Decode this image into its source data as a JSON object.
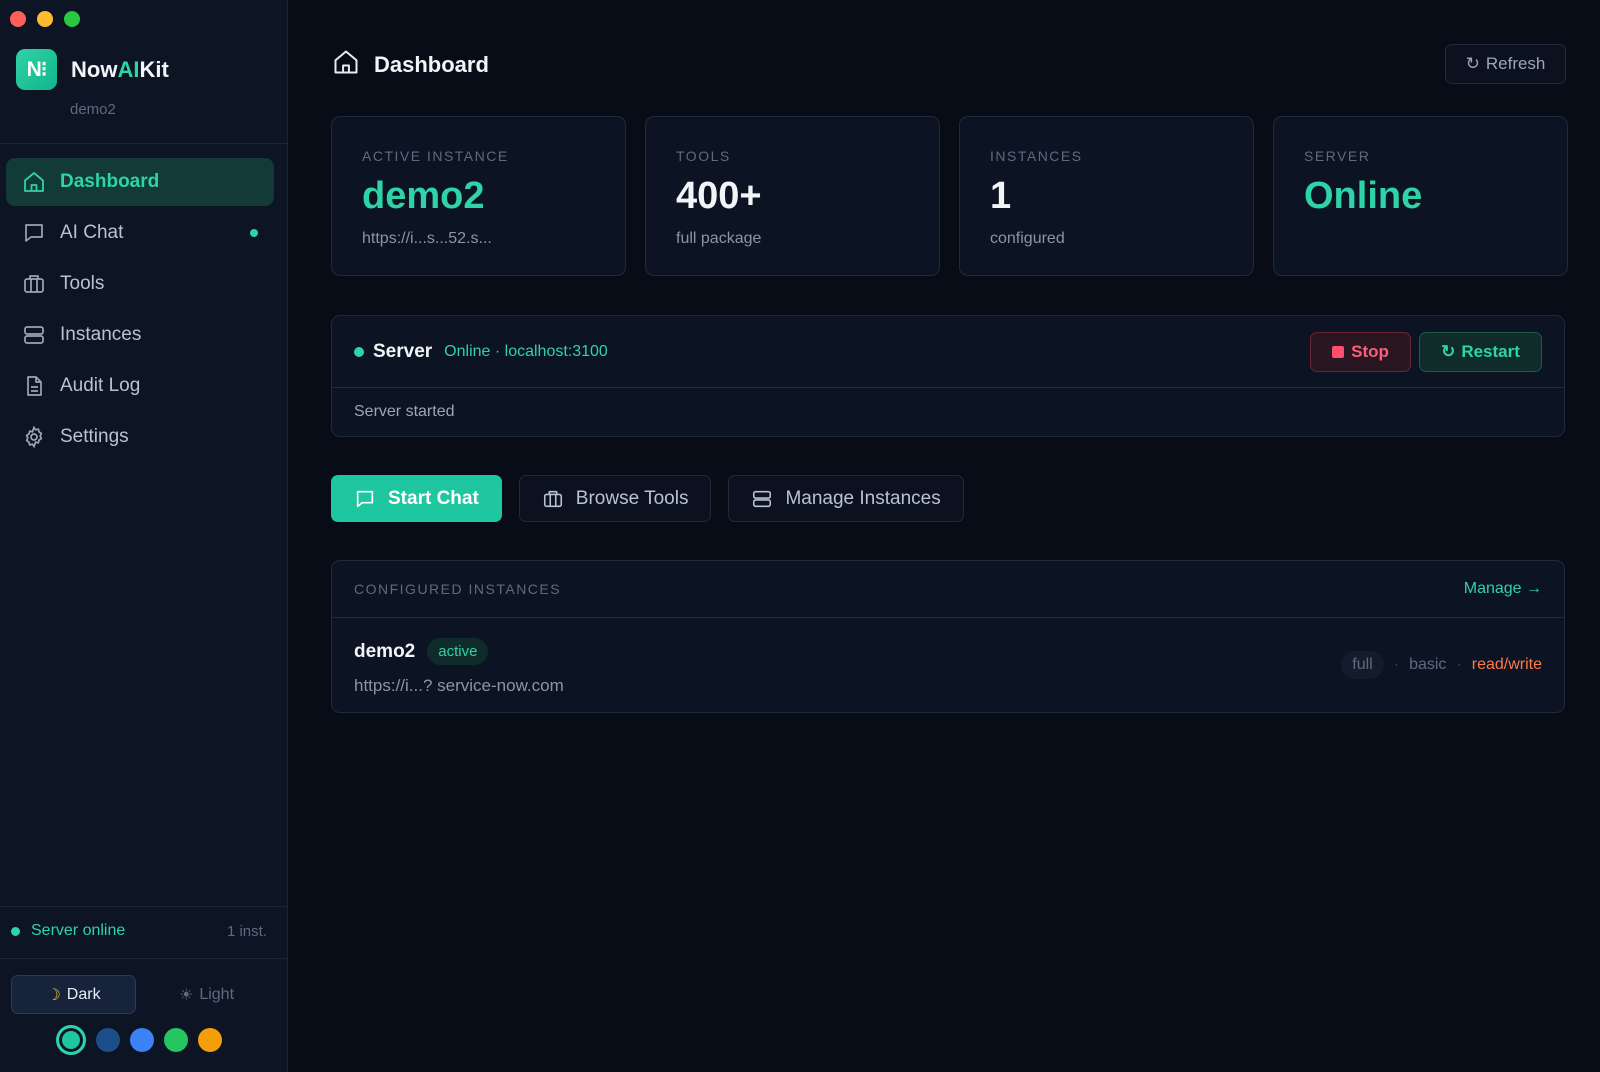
{
  "app": {
    "name_prefix": "Now",
    "name_ai": "AI",
    "name_suffix": "Kit",
    "subtitle": "demo2",
    "logo_text": "N⁝"
  },
  "sidebar": {
    "items": [
      {
        "label": "Dashboard",
        "icon": "home-icon",
        "active": true
      },
      {
        "label": "AI Chat",
        "icon": "chat-icon",
        "has_dot": true
      },
      {
        "label": "Tools",
        "icon": "briefcase-icon"
      },
      {
        "label": "Instances",
        "icon": "server-icon"
      },
      {
        "label": "Audit Log",
        "icon": "document-icon"
      },
      {
        "label": "Settings",
        "icon": "gear-icon"
      }
    ],
    "status_text": "Server online",
    "status_count": "1 inst.",
    "theme": {
      "dark_label": "Dark",
      "light_label": "Light",
      "selected": "Dark"
    },
    "accent_swatches": [
      "#1ec7a0",
      "#1b4f8a",
      "#3b82f6",
      "#22c55e",
      "#f59e0b"
    ]
  },
  "header": {
    "title": "Dashboard",
    "refresh_label": "Refresh"
  },
  "stats": [
    {
      "label": "ACTIVE INSTANCE",
      "value": "demo2",
      "sub": "https://i...s...52.s...",
      "accent": true
    },
    {
      "label": "TOOLS",
      "value": "400+",
      "sub": "full package"
    },
    {
      "label": "INSTANCES",
      "value": "1",
      "sub": "configured"
    },
    {
      "label": "SERVER",
      "value": "Online",
      "sub": "",
      "accent": true
    }
  ],
  "server": {
    "name": "Server",
    "info": "Online · localhost:3100",
    "stop_label": "Stop",
    "restart_label": "Restart",
    "log": "Server started"
  },
  "quick_actions": [
    {
      "label": "Start Chat",
      "icon": "chat-icon",
      "primary": true
    },
    {
      "label": "Browse Tools",
      "icon": "briefcase-icon"
    },
    {
      "label": "Manage Instances",
      "icon": "server-icon"
    }
  ],
  "instances_panel": {
    "title": "CONFIGURED INSTANCES",
    "manage_label": "Manage →",
    "rows": [
      {
        "name": "demo2",
        "badge": "active",
        "url": "https://i...? service-now.com",
        "tags": {
          "package": "full",
          "auth": "basic",
          "mode": "read/write"
        }
      }
    ]
  },
  "colors": {
    "accent": "#1ec7a0",
    "danger": "#ff4d6d",
    "warning": "#ff7a45",
    "bg": "#080c16"
  }
}
